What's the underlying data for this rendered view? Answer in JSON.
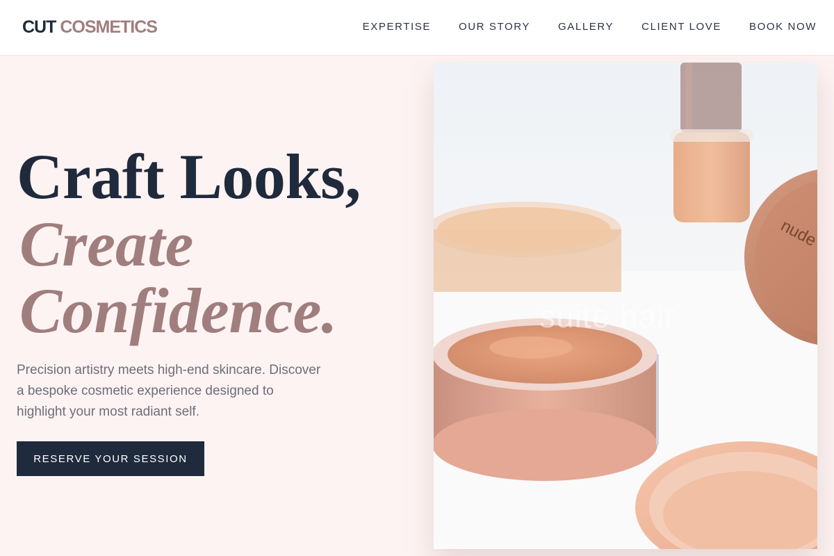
{
  "brand": {
    "word1": "CUT",
    "word2": "COSMETICS"
  },
  "nav": {
    "items": [
      {
        "label": "EXPERTISE"
      },
      {
        "label": "OUR STORY"
      },
      {
        "label": "GALLERY"
      },
      {
        "label": "CLIENT LOVE"
      },
      {
        "label": "BOOK NOW"
      }
    ]
  },
  "hero": {
    "line1": "Craft Looks,",
    "line2": "Create",
    "line3": "Confidence.",
    "description": "Precision artistry meets high-end skincare. Discover a bespoke cosmetic experience designed to highlight your most radiant self.",
    "cta_label": "RESERVE YOUR SESSION",
    "image_watermark": "suite hair",
    "lid_text": "nude"
  },
  "colors": {
    "navy": "#1f2a3c",
    "mauve": "#a07e7e",
    "background": "#fdf3f2"
  }
}
